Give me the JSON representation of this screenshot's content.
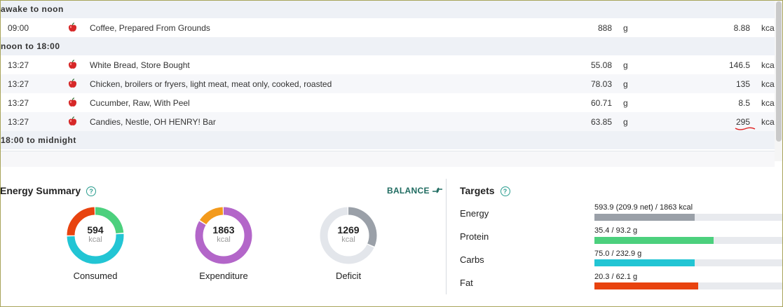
{
  "diary": {
    "groups": [
      {
        "title": "awake to noon",
        "rows": [
          {
            "time": "09:00",
            "name": "Coffee, Prepared From Grounds",
            "amount": "888",
            "unit": "g",
            "calories": "8.88",
            "cal_unit": "kcal"
          }
        ]
      },
      {
        "title": "noon to 18:00",
        "rows": [
          {
            "time": "13:27",
            "name": "White Bread, Store Bought",
            "amount": "55.08",
            "unit": "g",
            "calories": "146.5",
            "cal_unit": "kcal"
          },
          {
            "time": "13:27",
            "name": "Chicken, broilers or fryers, light meat, meat only, cooked, roasted",
            "amount": "78.03",
            "unit": "g",
            "calories": "135",
            "cal_unit": "kcal"
          },
          {
            "time": "13:27",
            "name": "Cucumber, Raw, With Peel",
            "amount": "60.71",
            "unit": "g",
            "calories": "8.5",
            "cal_unit": "kcal"
          },
          {
            "time": "13:27",
            "name": "Candies, Nestle, OH HENRY! Bar",
            "amount": "63.85",
            "unit": "g",
            "calories": "295",
            "cal_unit": "kcal"
          }
        ]
      },
      {
        "title": "18:00 to midnight",
        "rows": []
      }
    ],
    "food_icon": "apple-icon"
  },
  "energy_summary": {
    "title": "Energy Summary",
    "balance_label": "BALANCE",
    "consumed": {
      "value": "594",
      "unit": "kcal",
      "label": "Consumed"
    },
    "expenditure": {
      "value": "1863",
      "unit": "kcal",
      "label": "Expenditure"
    },
    "deficit": {
      "value": "1269",
      "unit": "kcal",
      "label": "Deficit"
    }
  },
  "targets": {
    "title": "Targets",
    "items": [
      {
        "label": "Energy",
        "text": "593.9 (209.9 net) / 1863 kcal",
        "fraction": 0.53,
        "color": "#9aa0a8"
      },
      {
        "label": "Protein",
        "text": "35.4 / 93.2 g",
        "fraction": 0.632,
        "color": "#4cd07d"
      },
      {
        "label": "Carbs",
        "text": "75.0 / 232.9 g",
        "fraction": 0.532,
        "color": "#22c5d4"
      },
      {
        "label": "Fat",
        "text": "20.3 / 62.1 g",
        "fraction": 0.55,
        "color": "#e8430f"
      }
    ]
  },
  "donut_segments": {
    "consumed": [
      {
        "name": "protein",
        "fraction": 0.24,
        "color": "#4cd07d"
      },
      {
        "name": "carbs",
        "fraction": 0.51,
        "color": "#22c5d4"
      },
      {
        "name": "fat",
        "fraction": 0.25,
        "color": "#e8430f"
      }
    ],
    "expenditure": [
      {
        "name": "bmr",
        "fraction": 0.84,
        "color": "#b366c9"
      },
      {
        "name": "activity",
        "fraction": 0.16,
        "color": "#f39a1c"
      }
    ],
    "deficit": [
      {
        "name": "deficit",
        "fraction": 0.32,
        "color": "#9aa0a8"
      },
      {
        "name": "remaining",
        "fraction": 0.68,
        "color": "#e3e6eb"
      }
    ]
  }
}
